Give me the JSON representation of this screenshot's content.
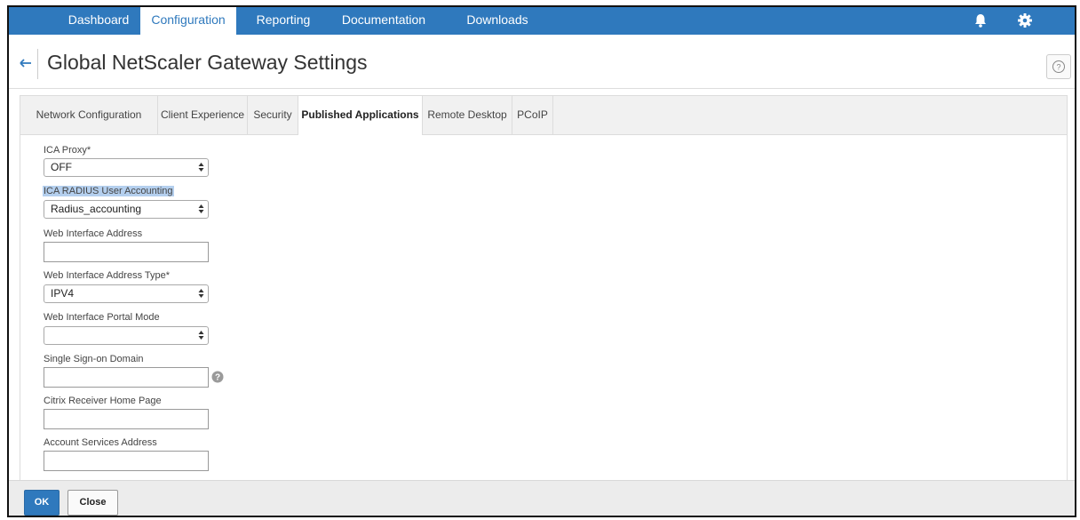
{
  "nav": {
    "tabs": [
      {
        "label": "Dashboard"
      },
      {
        "label": "Configuration"
      },
      {
        "label": "Reporting"
      },
      {
        "label": "Documentation"
      },
      {
        "label": "Downloads"
      }
    ],
    "active_tab": "Configuration",
    "icons": [
      "bell-icon",
      "gear-icon"
    ],
    "color": "#2f79bd"
  },
  "header": {
    "title": "Global NetScaler Gateway Settings"
  },
  "tabs": [
    {
      "label": "Network Configuration"
    },
    {
      "label": "Client Experience"
    },
    {
      "label": "Security"
    },
    {
      "label": "Published Applications"
    },
    {
      "label": "Remote Desktop"
    },
    {
      "label": "PCoIP"
    }
  ],
  "active_tab": "Published Applications",
  "form": {
    "ica_proxy": {
      "label": "ICA Proxy*",
      "value": "OFF"
    },
    "ica_radius": {
      "label": "ICA RADIUS User Accounting",
      "value": "Radius_accounting"
    },
    "wi_address": {
      "label": "Web Interface Address",
      "value": ""
    },
    "wi_address_type": {
      "label": "Web Interface Address Type*",
      "value": "IPV4"
    },
    "wi_portal_mode": {
      "label": "Web Interface Portal Mode",
      "value": ""
    },
    "sso_domain": {
      "label": "Single Sign-on Domain",
      "value": ""
    },
    "receiver_home": {
      "label": "Citrix Receiver Home Page",
      "value": ""
    },
    "account_services": {
      "label": "Account Services Address",
      "value": ""
    }
  },
  "footer": {
    "ok_label": "OK",
    "close_label": "Close"
  }
}
